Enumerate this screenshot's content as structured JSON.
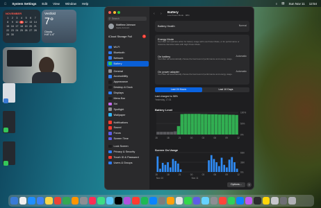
{
  "menubar": {
    "app": "System Settings",
    "items": [
      "Edit",
      "View",
      "Window",
      "Help"
    ],
    "date": "Sun Nov 11",
    "time": "12:54"
  },
  "calendar": {
    "month": "NOVEMBER",
    "days": [
      "1",
      "2",
      "3",
      "4",
      "5",
      "6",
      "7",
      "8",
      "9",
      "10",
      "11",
      "12",
      "13",
      "14",
      "15",
      "16",
      "17",
      "18",
      "19",
      "20",
      "21",
      "22",
      "23",
      "24",
      "25",
      "26",
      "27",
      "28",
      "29",
      "30"
    ]
  },
  "weather": {
    "location": "Vestfold",
    "temp": "7°",
    "condition": "Cloudy",
    "hilo": "H:8° L:4°"
  },
  "sidebar": {
    "search_placeholder": "Search",
    "user_name": "Matthew Johnson",
    "user_sub": "Apple Account",
    "storage_label": "iCloud Storage Full",
    "storage_badge": "1",
    "items": [
      {
        "label": "Wi-Fi",
        "color": "#2f7cf6"
      },
      {
        "label": "Bluetooth",
        "color": "#2f7cf6"
      },
      {
        "label": "Network",
        "color": "#2f7cf6"
      },
      {
        "label": "Battery",
        "color": "#34c759"
      },
      {
        "label": "General",
        "color": "#8e8e93"
      },
      {
        "label": "Accessibility",
        "color": "#2f7cf6"
      },
      {
        "label": "Appearance",
        "color": "#1c1c1e"
      },
      {
        "label": "Desktop & Dock",
        "color": "#1c1c1e"
      },
      {
        "label": "Displays",
        "color": "#2f7cf6"
      },
      {
        "label": "Menu Bar",
        "color": "#1c1c1e"
      },
      {
        "label": "Siri",
        "color": "#c56bf0"
      },
      {
        "label": "Spotlight",
        "color": "#8e8e93"
      },
      {
        "label": "Wallpaper",
        "color": "#2fb7f6"
      },
      {
        "label": "Notifications",
        "color": "#ff3b30"
      },
      {
        "label": "Sound",
        "color": "#ff3b30"
      },
      {
        "label": "Focus",
        "color": "#5e5ce6"
      },
      {
        "label": "Screen Time",
        "color": "#5e5ce6"
      },
      {
        "label": "Lock Screen",
        "color": "#1c1c1e"
      },
      {
        "label": "Privacy & Security",
        "color": "#2f7cf6"
      },
      {
        "label": "Touch ID & Password",
        "color": "#ff3b30"
      },
      {
        "label": "Users & Groups",
        "color": "#2f7cf6"
      }
    ]
  },
  "main": {
    "title": "Battery",
    "subtitle": "Low Power Mode · 98%",
    "battery_health_label": "Battery Health",
    "battery_health_value": "Normal",
    "energy_mode_label": "Energy Mode",
    "energy_mode_desc": "Your Mac can optimize either for battery usage with Low Power Mode, or for performance or resource-intensive tasks with High Power Mode.",
    "on_battery_label": "On battery",
    "on_battery_value": "Automatic",
    "on_battery_desc": "Your Mac will automatically choose the best level of performance and energy usage.",
    "on_adapter_label": "On power adapter",
    "on_adapter_value": "Automatic",
    "on_adapter_desc": "Your Mac will automatically choose the best level of performance and energy usage.",
    "tab_24h": "Last 24 Hours",
    "tab_10d": "Last 10 Days",
    "last_charged": "Last charged to 98%",
    "last_charged_time": "Yesterday, 17:31",
    "battery_chart_title": "Battery Level",
    "screen_chart_title": "Screen On Usage",
    "options_button": "Options...",
    "help_button": "?"
  },
  "chart_data": [
    {
      "type": "area",
      "title": "Battery Level",
      "x": [
        "15",
        "18",
        "21",
        "00",
        "03",
        "06",
        "09",
        "12"
      ],
      "ylabels": [
        "100%",
        "50%",
        "0%"
      ],
      "ylim": [
        0,
        100
      ],
      "values": [
        12,
        12,
        12,
        12,
        12,
        14,
        38,
        92,
        93,
        93,
        93,
        93,
        93,
        92,
        92,
        91,
        91,
        91,
        90,
        90,
        90,
        89,
        89,
        88
      ]
    },
    {
      "type": "bar",
      "title": "Screen On Usage",
      "x": [
        "15",
        "18",
        "21",
        "00",
        "03",
        "06",
        "09",
        "12"
      ],
      "ylabels": [
        "60m",
        "30m",
        "0m"
      ],
      "ylim": [
        0,
        60
      ],
      "xsub": [
        "Nov 10",
        "Nov 11"
      ],
      "values": [
        48,
        10,
        28,
        22,
        30,
        14,
        40,
        34,
        26,
        8,
        0,
        0,
        0,
        0,
        0,
        0,
        0,
        0,
        0,
        0,
        36,
        52,
        40,
        30,
        18,
        44,
        22,
        14,
        38,
        46,
        30,
        10
      ]
    }
  ],
  "dock": {
    "colors": [
      "#3a7bd5",
      "#f0f0f0",
      "#1f8fff",
      "#3b82f6",
      "#f9d649",
      "#ea4335",
      "#34a853",
      "#ff9500",
      "#8e8e93",
      "#ff2d55",
      "#3ddc84",
      "#5ac8fa",
      "#000000",
      "#af52de",
      "#ff3b30",
      "#1db954",
      "#0a84ff",
      "#7d7d7d",
      "#ff9f0a",
      "#e5e5e5",
      "#32d74b",
      "#5e5ce6",
      "#64d2ff",
      "#8e8e93",
      "#ff453a",
      "#30d158",
      "#0a84ff",
      "#bf5af2",
      "#2c2c2e",
      "#ffd60a",
      "#c7c7cc",
      "#6e6e73",
      "#b0b0b5"
    ]
  }
}
